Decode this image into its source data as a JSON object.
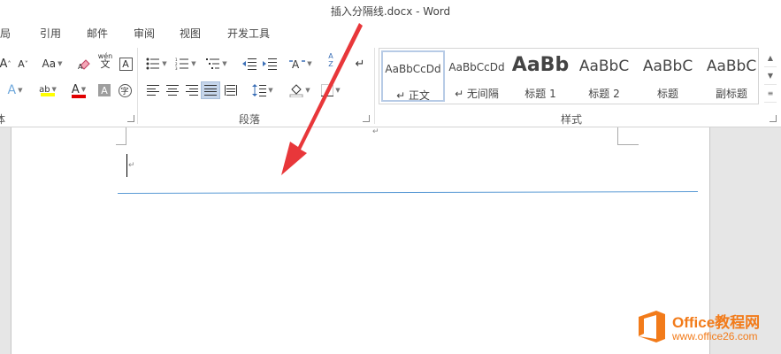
{
  "window": {
    "title": "插入分隔线.docx - Word"
  },
  "tabs": [
    "布局",
    "引用",
    "邮件",
    "审阅",
    "视图",
    "开发工具"
  ],
  "ribbon": {
    "font_group_label": "体",
    "paragraph_group_label": "段落",
    "styles_group_label": "样式",
    "font_buttons": {
      "grow": "A",
      "shrink": "A",
      "case": "Aa",
      "pinyin_top": "wén",
      "pinyin_bottom": "文",
      "char_border": "A",
      "text_effect": "A",
      "highlight": "ab",
      "font_color": "A",
      "char_shading": "A",
      "enclose": "字"
    },
    "paragraph_buttons": {
      "sort": "A Z",
      "show_marks": "↵"
    }
  },
  "styles": [
    {
      "sample": "AaBbCcDd",
      "name": "↵ 正文",
      "size": 12,
      "weight": "normal"
    },
    {
      "sample": "AaBbCcDd",
      "name": "↵ 无间隔",
      "size": 12,
      "weight": "normal"
    },
    {
      "sample": "AaBb",
      "name": "标题 1",
      "size": 22,
      "weight": "bold"
    },
    {
      "sample": "AaBbC",
      "name": "标题 2",
      "size": 17,
      "weight": "normal"
    },
    {
      "sample": "AaBbC",
      "name": "标题",
      "size": 17,
      "weight": "normal"
    },
    {
      "sample": "AaBbC",
      "name": "副标题",
      "size": 17,
      "weight": "normal"
    }
  ],
  "document": {
    "paragraph_mark": "↵",
    "top_mark": "↵"
  },
  "watermark": {
    "brand": "Office教程网",
    "url": "www.office26.com"
  },
  "colors": {
    "divider_line": "#5b9bd5",
    "arrow": "#e8373a",
    "highlight_yellow": "#ffff00",
    "font_color_red": "#e00000",
    "watermark_orange": "#f27b1a"
  }
}
